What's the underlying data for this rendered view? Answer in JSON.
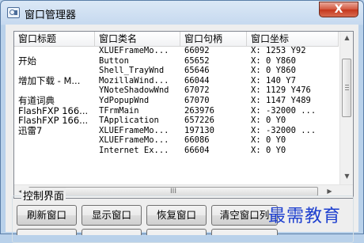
{
  "window": {
    "title": "窗口管理器",
    "close_glyph": "X"
  },
  "listview": {
    "columns": [
      "窗口标题",
      "窗口类名",
      "窗口句柄",
      "窗口坐标"
    ],
    "rows": [
      {
        "title": "",
        "class": "XLUEFrameMo...",
        "handle": "66092",
        "coords": "X: 1253   Y92"
      },
      {
        "title": "开始",
        "class": "Button",
        "handle": "65652",
        "coords": "X: 0    Y860"
      },
      {
        "title": "",
        "class": "Shell_TrayWnd",
        "handle": "65646",
        "coords": "X: 0    Y860"
      },
      {
        "title": "增加下载 - M...",
        "class": "MozillaWind...",
        "handle": "66044",
        "coords": "X: 140    Y7"
      },
      {
        "title": "",
        "class": "YNoteShadowWnd",
        "handle": "67072",
        "coords": "X: 1129   Y476"
      },
      {
        "title": "有道词典",
        "class": "YdPopupWnd",
        "handle": "67070",
        "coords": "X: 1147   Y489"
      },
      {
        "title": "FlashFXP 166...",
        "class": "TFrmMain",
        "handle": "263976",
        "coords": "X: -32000  ..."
      },
      {
        "title": "FlashFXP 166...",
        "class": "TApplication",
        "handle": "657226",
        "coords": "X: 0    Y0"
      },
      {
        "title": "迅雷7",
        "class": "XLUEFrameMo...",
        "handle": "197130",
        "coords": "X: -32000  ..."
      },
      {
        "title": "",
        "class": "XLUEFrameMo...",
        "handle": "66086",
        "coords": "X: 0    Y0"
      },
      {
        "title": "",
        "class": "Internet Ex...",
        "handle": "66604",
        "coords": "X: 0    Y0"
      }
    ],
    "hscroll_grip": "III"
  },
  "control": {
    "group_label": "控制界面",
    "buttons": [
      "刷新窗口",
      "显示窗口",
      "恢复窗口",
      "清空窗口列"
    ]
  },
  "watermark": "最需教育",
  "colors": {
    "titlebar": "#c6d9ef",
    "close": "#c4371d",
    "watermark": "#1d3fcf"
  }
}
